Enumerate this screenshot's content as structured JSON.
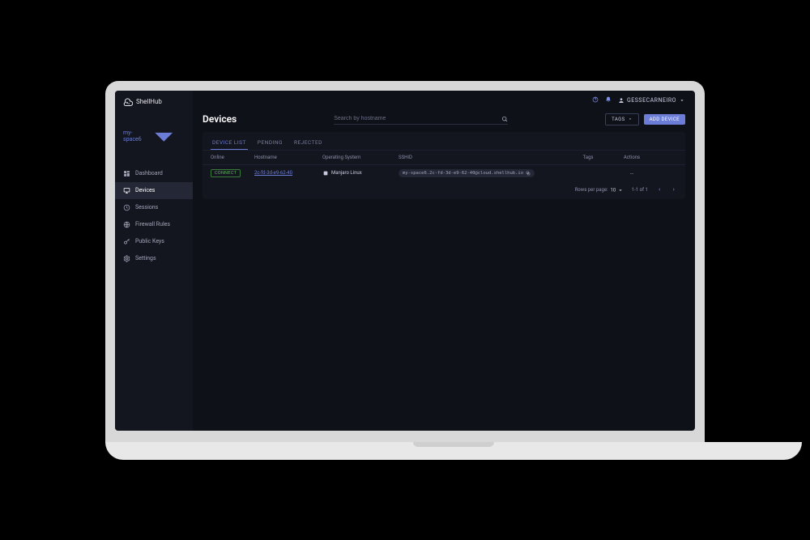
{
  "brand": "ShellHub",
  "namespace": {
    "name": "my-space6"
  },
  "sidebar": {
    "items": [
      {
        "label": "Dashboard"
      },
      {
        "label": "Devices"
      },
      {
        "label": "Sessions"
      },
      {
        "label": "Firewall Rules"
      },
      {
        "label": "Public Keys"
      },
      {
        "label": "Settings"
      }
    ]
  },
  "header": {
    "username": "GESSECARNEIRO"
  },
  "page": {
    "title": "Devices",
    "searchPlaceholder": "Search by hostname",
    "tagsBtn": "TAGS",
    "addBtn": "ADD DEVICE"
  },
  "tabs": [
    {
      "label": "DEVICE LIST"
    },
    {
      "label": "PENDING"
    },
    {
      "label": "REJECTED"
    }
  ],
  "table": {
    "cols": {
      "online": "Online",
      "hostname": "Hostname",
      "os": "Operating System",
      "sshid": "SSHID",
      "tags": "Tags",
      "actions": "Actions"
    },
    "row": {
      "onlineLabel": "CONNECT",
      "hostname": "2c-fd-3d-e9-62-40",
      "os": "Manjaro Linux",
      "sshid": "my-space6.2c-fd-3d-e9-62-40@cloud.shellhub.io",
      "actions": "…"
    }
  },
  "pagination": {
    "rowsLabel": "Rows per page:",
    "pageSize": "10",
    "range": "1-1 of 1"
  }
}
